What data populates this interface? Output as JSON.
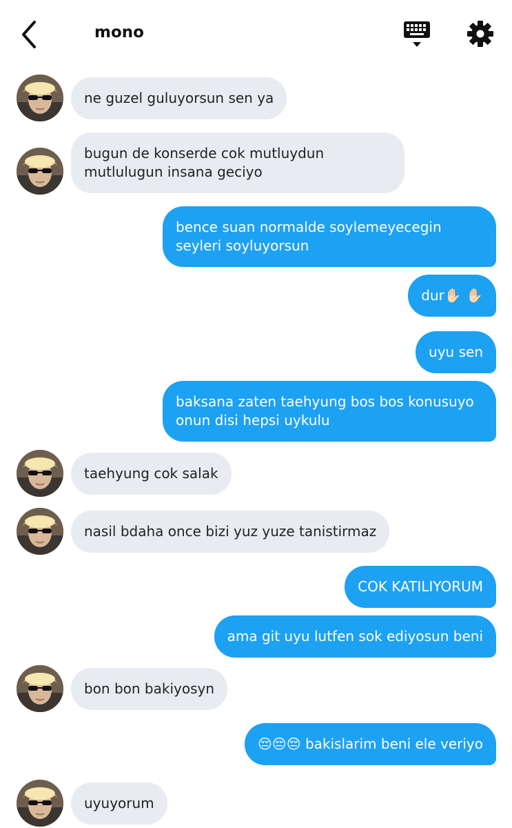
{
  "header": {
    "title": "mono",
    "back_icon": "chevron-left-icon",
    "keyboard_icon": "keyboard-icon",
    "settings_icon": "gear-icon"
  },
  "colors": {
    "incoming_bubble": "#e8ebf0",
    "outgoing_bubble": "#1da1f2"
  },
  "messages": [
    {
      "dir": "in",
      "text": "ne guzel guluyorsun sen ya"
    },
    {
      "dir": "in",
      "text": "bugun de konserde cok mutluydun\nmutlulugun insana geciyo"
    },
    {
      "dir": "out",
      "text": "bence suan normalde soylemeyecegin\nseyleri soyluyorsun"
    },
    {
      "dir": "out",
      "text": "dur✋🏻 ✋🏻"
    },
    {
      "dir": "out",
      "text": "uyu sen"
    },
    {
      "dir": "out",
      "text": "baksana zaten taehyung bos bos konusuyo\nonun disi hepsi uykulu"
    },
    {
      "dir": "in",
      "text": "taehyung cok salak"
    },
    {
      "dir": "in",
      "text": "nasil bdaha once bizi yuz yuze tanistirmaz"
    },
    {
      "dir": "out",
      "text": "COK KATILIYORUM"
    },
    {
      "dir": "out",
      "text": "ama git uyu lutfen sok ediyosun beni"
    },
    {
      "dir": "in",
      "text": "bon bon bakiyosyn"
    },
    {
      "dir": "out",
      "text": "😔😔😔 bakislarim beni ele veriyo"
    },
    {
      "dir": "in",
      "text": "uyuyorum"
    }
  ]
}
